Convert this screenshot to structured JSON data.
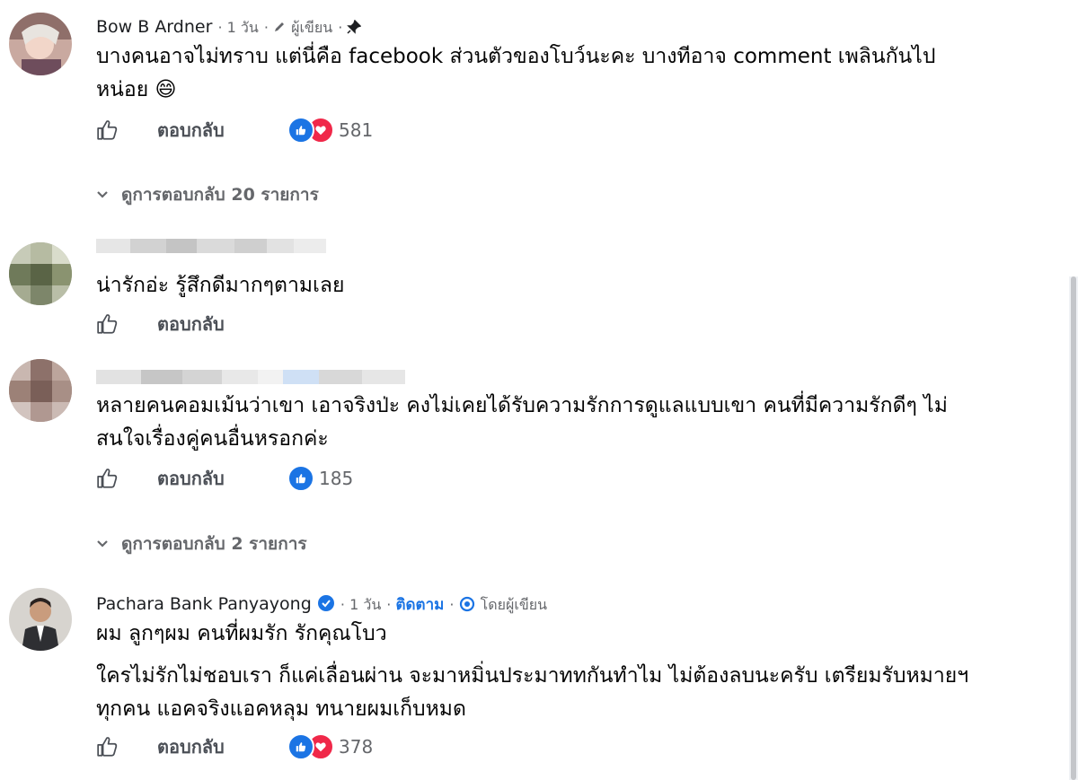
{
  "comments": [
    {
      "author": "Bow B Ardner",
      "time": "1 วัน",
      "author_badge": "ผู้เขียน",
      "text_lines": [
        "บางคนอาจไม่ทราบ แต่นี่คือ facebook ส่วนตัวของโบว์นะคะ บางทีอาจ comment เพลินกันไป",
        "หน่อย 😄"
      ],
      "reply_label": "ตอบกลับ",
      "reaction_count": "581",
      "view_replies": "ดูการตอบกลับ 20 รายการ"
    },
    {
      "author": "",
      "text_lines": [
        "น่ารักอ่ะ รู้สึกดีมากๆตามเลย"
      ],
      "reply_label": "ตอบกลับ"
    },
    {
      "author": "",
      "text_lines": [
        "หลายคนคอมเม้นว่าเขา เอาจริงป่ะ คงไม่เคยได้รับความรักการดูแลแบบเขา คนที่มีความรักดีๆ ไม่",
        "สนใจเรื่องคู่คนอื่นหรอกค่ะ"
      ],
      "reply_label": "ตอบกลับ",
      "reaction_count": "185",
      "view_replies": "ดูการตอบกลับ 2 รายการ"
    },
    {
      "author": "Pachara Bank Panyayong",
      "time": "1 วัน",
      "follow_label": "ติดตาม",
      "badge": "โดยผู้เขียน",
      "paragraph1": "ผม ลูกๆผม คนที่ผมรัก รักคุณโบว",
      "text_lines": [
        "ใครไม่รักไม่ชอบเรา ก็แค่เลื่อนผ่าน จะมาหมิ่นประมาททกันทำไม ไม่ต้องลบนะครับ เตรียมรับหมายฯ",
        "ทุกคน แอคจริงแอคหลุม ทนายผมเก็บหมด"
      ],
      "reply_label": "ตอบกลับ",
      "reaction_count": "378"
    }
  ],
  "colors": {
    "like": "#1b74e4",
    "love": "#f02849",
    "link": "#1b74e4",
    "muted": "#65676b"
  }
}
